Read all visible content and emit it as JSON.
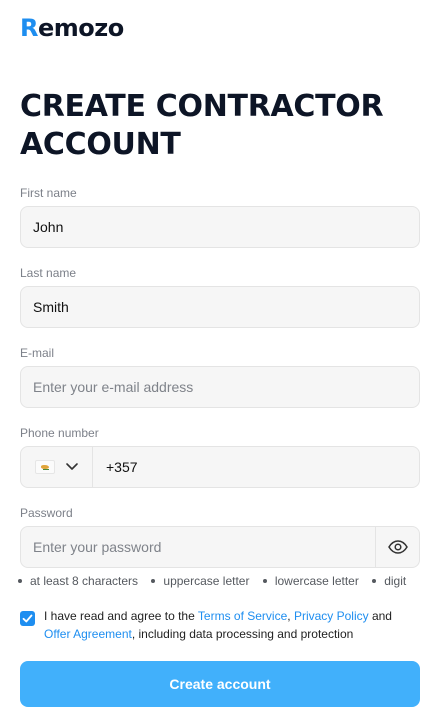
{
  "brand": {
    "logo_first": "R",
    "logo_rest": "emozo"
  },
  "page": {
    "title": "CREATE CONTRACTOR ACCOUNT"
  },
  "form": {
    "first_name": {
      "label": "First name",
      "value": "John",
      "placeholder": ""
    },
    "last_name": {
      "label": "Last name",
      "value": "Smith",
      "placeholder": ""
    },
    "email": {
      "label": "E-mail",
      "value": "",
      "placeholder": "Enter your e-mail address"
    },
    "phone": {
      "label": "Phone number",
      "value": "+357",
      "country_icon": "cyprus-flag-icon"
    },
    "password": {
      "label": "Password",
      "value": "",
      "placeholder": "Enter your password",
      "toggle_icon": "eye-icon"
    },
    "password_rules": [
      "at least 8 characters",
      "uppercase letter",
      "lowercase letter",
      "digit"
    ],
    "consent": {
      "checked": true,
      "prefix": "I have read and agree to the ",
      "terms": "Terms of Service",
      "sep1": ", ",
      "privacy": "Privacy Policy",
      "sep2": " and ",
      "offer": "Offer Agreement",
      "suffix": ", including data processing and protection"
    },
    "submit_label": "Create account"
  },
  "colors": {
    "accent": "#1e8ef0",
    "button": "#41b0fb",
    "title": "#0d1526"
  }
}
